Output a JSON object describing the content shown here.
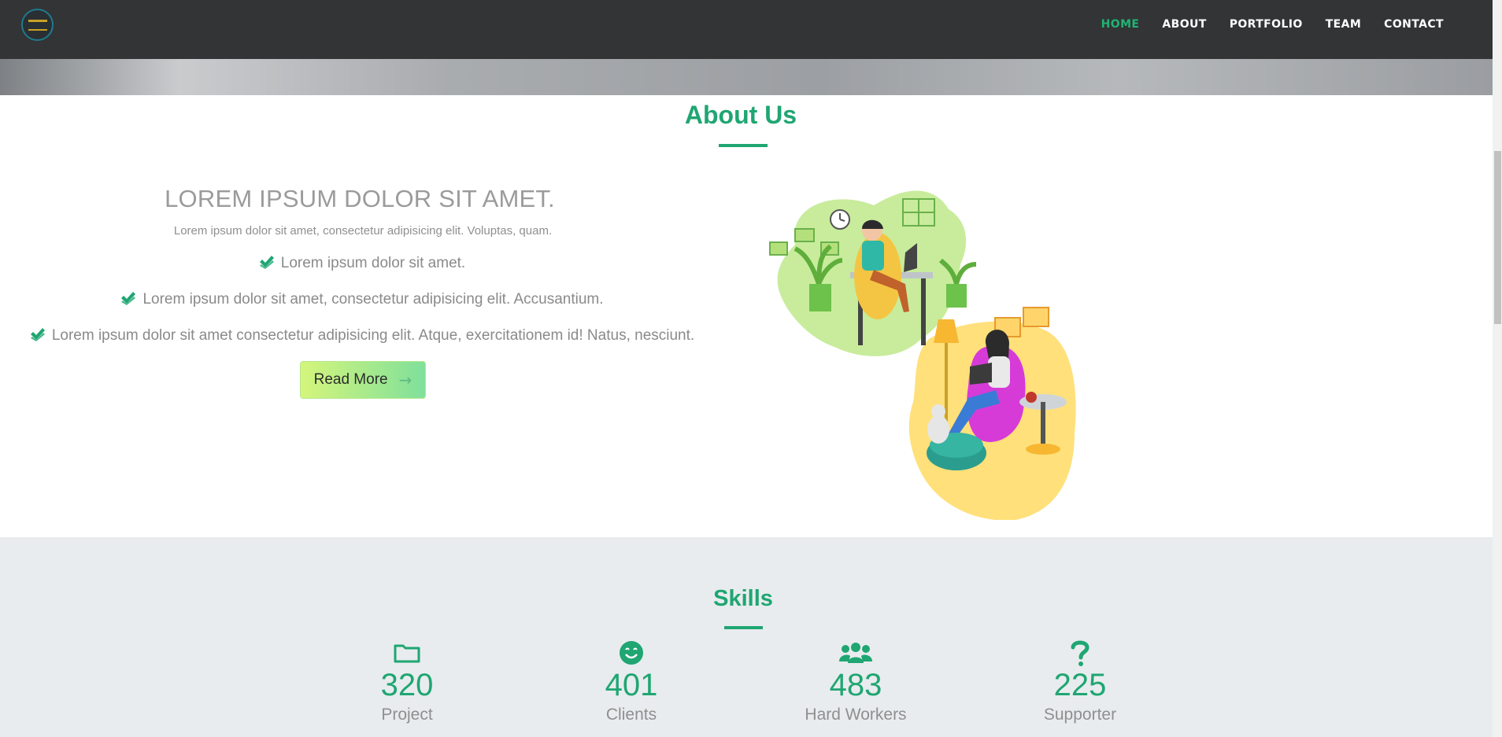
{
  "nav": {
    "links": [
      "HOME",
      "ABOUT",
      "PORTFOLIO",
      "TEAM",
      "CONTACT"
    ],
    "active_color": "#1fb574",
    "logo_icon": "brand-logo-icon"
  },
  "about": {
    "title": "About Us",
    "headline": "LOREM IPSUM DOLOR SIT AMET.",
    "subline": "Lorem ipsum dolor sit amet, consectetur adipisicing elit. Voluptas, quam.",
    "checks": [
      "Lorem ipsum dolor sit amet.",
      "Lorem ipsum dolor sit amet, consectetur adipisicing elit. Accusantium.",
      "Lorem ipsum dolor sit amet consectetur adipisicing elit. Atque, exercitationem id! Natus, nesciunt."
    ],
    "button": "Read More",
    "accent_color": "#1fa672"
  },
  "skills": {
    "title": "Skills",
    "stats": [
      {
        "icon": "folder-icon",
        "value": "320",
        "label": "Project"
      },
      {
        "icon": "smile-icon",
        "value": "401",
        "label": "Clients"
      },
      {
        "icon": "users-icon",
        "value": "483",
        "label": "Hard Workers"
      },
      {
        "icon": "question-icon",
        "value": "225",
        "label": "Supporter"
      }
    ]
  }
}
